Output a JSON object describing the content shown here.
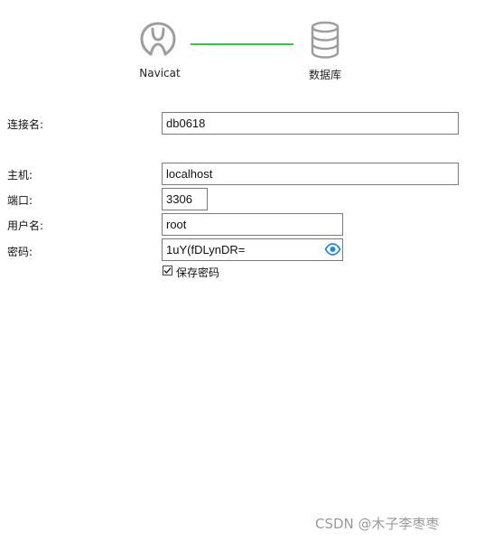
{
  "header": {
    "step1_label": "Navicat",
    "step2_label": "数据库",
    "connector_color": "#2ecc40",
    "icon_color": "#9e9e9e",
    "step1_icon": "navicat-logo-icon",
    "step2_icon": "database-icon"
  },
  "form": {
    "connection_name": {
      "label": "连接名:",
      "value": "db0618"
    },
    "host": {
      "label": "主机:",
      "value": "localhost"
    },
    "port": {
      "label": "端口:",
      "value": "3306"
    },
    "username": {
      "label": "用户名:",
      "value": "root"
    },
    "password": {
      "label": "密码:",
      "value": "1uY(fDLynDR=",
      "toggle_icon": "eye-icon",
      "toggle_color": "#1e88e5"
    },
    "save_password": {
      "label": "保存密码",
      "checked": true
    }
  },
  "watermark": "CSDN @木子李枣枣"
}
